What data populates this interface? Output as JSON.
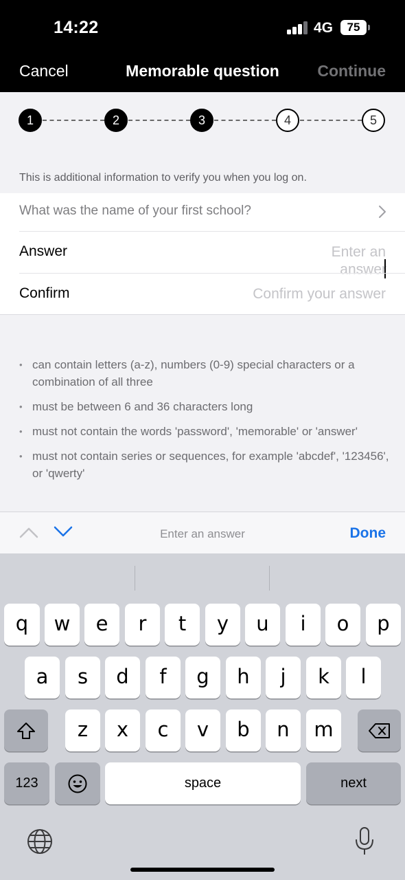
{
  "status_bar": {
    "time": "14:22",
    "network": "4G",
    "battery": "75"
  },
  "nav": {
    "cancel": "Cancel",
    "title": "Memorable question",
    "continue": "Continue"
  },
  "stepper": {
    "steps": [
      "1",
      "2",
      "3",
      "4",
      "5"
    ],
    "current_step": 3
  },
  "info_text": "This is additional information to verify you when you log on.",
  "form": {
    "question": "What was the name of your first school?",
    "answer_label": "Answer",
    "answer_placeholder": "Enter an answer",
    "confirm_label": "Confirm",
    "confirm_placeholder": "Confirm your answer"
  },
  "rules": [
    "can contain letters (a-z), numbers (0-9) special characters or a combination of all three",
    "must be between 6 and 36 characters long",
    "must not contain the words 'password', 'memorable' or 'answer'",
    "must not contain series or sequences, for example 'abcdef', '123456', or 'qwerty'"
  ],
  "accessory": {
    "hint": "Enter an answer",
    "done": "Done"
  },
  "keyboard": {
    "row1": [
      "q",
      "w",
      "e",
      "r",
      "t",
      "y",
      "u",
      "i",
      "o",
      "p"
    ],
    "row2": [
      "a",
      "s",
      "d",
      "f",
      "g",
      "h",
      "j",
      "k",
      "l"
    ],
    "row3": [
      "z",
      "x",
      "c",
      "v",
      "b",
      "n",
      "m"
    ],
    "numbers": "123",
    "space": "space",
    "next": "next"
  },
  "colors": {
    "accent": "#1a73e8",
    "nav_bg": "#000000",
    "keyboard_bg": "#d1d3d9"
  }
}
